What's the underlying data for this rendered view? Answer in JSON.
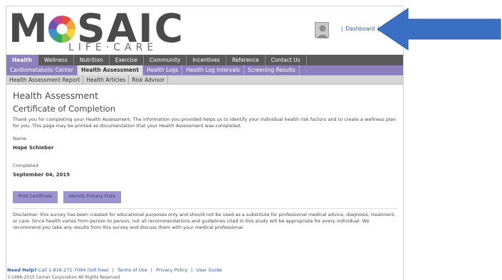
{
  "header": {
    "logo_text_left": "M",
    "logo_text_right": "SAIC",
    "logo_sub": "LIFE·CARE",
    "sep_left": "|",
    "dashboard_label": "Dashboard",
    "sep_right": "|"
  },
  "nav": {
    "primary": [
      "Health",
      "Wellness",
      "Nutrition",
      "Exercise",
      "Community",
      "Incentives",
      "Reference",
      "Contact Us"
    ],
    "secondary": [
      "Cardiometabolic Center",
      "Health Assessment",
      "Health Logs",
      "Health Log Intervals",
      "Screening Results"
    ],
    "tertiary": [
      "Health Assessment Report",
      "Health Articles",
      "Risk Advisor"
    ]
  },
  "main": {
    "title": "Health Assessment",
    "subtitle": "Certificate of Completion",
    "intro": "Thank you for completing your Health Assessment. The information you provided helps us to identify your individual health risk factors and to create a wellness plan for you. This page may be printed as documentation that your Health Assessment was completed.",
    "name_label": "Name",
    "name_value": "Hope Schieber",
    "completed_label": "Completed",
    "completed_value": "September 04, 2015",
    "print_button": "Print Certificate",
    "risks_button": "Identify Primary Risks",
    "disclaimer": "Disclaimer: this survey has been created for educational purposes only and should not be used as a substitute for professional medical advice, diagnosis, treatment, or care. Since health varies from person to person, not all recommendations and guidelines cited in this study will be appropriate for every individual. We recommend you take any results from this survey and discuss them with your medical professional."
  },
  "footer": {
    "need_help": "Need Help?",
    "phone": "Call 1-816-271-7094 (toll free)",
    "sep": "|",
    "terms": "Terms of Use",
    "privacy": "Privacy Policy",
    "guide": "User Guide",
    "copyright": "©1996-2015 Cerner Corporation All Rights Reserved"
  },
  "colors": {
    "accent": "#8b7fbe",
    "nav_dark": "#5a5a5a",
    "arrow": "#3a6fc4",
    "link": "#2e5b9c"
  }
}
